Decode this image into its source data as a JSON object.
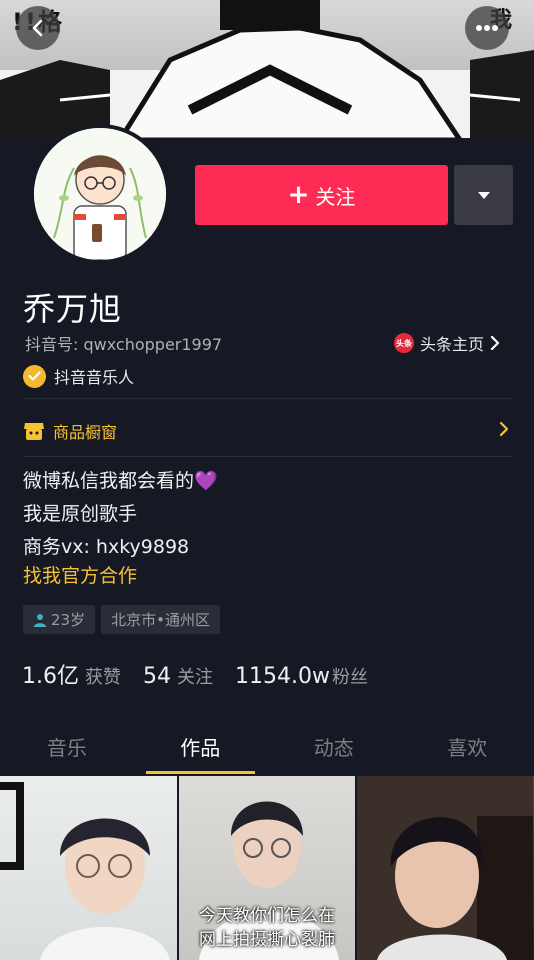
{
  "cover": {
    "text_left": "!!格",
    "text_right": "我"
  },
  "profile": {
    "name": "乔万旭",
    "douyin_id": "抖音号: qwxchopper1997",
    "toutiao_label": "头条主页",
    "toutiao_badge": "头条",
    "verified_label": "抖音音乐人",
    "follow_label": "关注",
    "follow_plus": "+",
    "shop_label": "商品橱窗",
    "bio": [
      "微博私信我都会看的💜",
      "我是原创歌手",
      "商务vx: hxky9898"
    ],
    "bio_link": "找我官方合作",
    "tags": {
      "age": "23岁",
      "location": "北京市•通州区"
    }
  },
  "stats": [
    {
      "num": "1.6亿",
      "label": "获赞"
    },
    {
      "num": "54",
      "label": "关注"
    },
    {
      "num": "1154.0w",
      "label": "粉丝"
    }
  ],
  "tabs": [
    "音乐",
    "作品",
    "动态",
    "喜欢"
  ],
  "active_tab": 1,
  "videos": [
    {
      "caption": ""
    },
    {
      "caption": "今天教你们怎么在\n网上拍摄撕心裂肺"
    },
    {
      "caption": ""
    }
  ],
  "colors": {
    "accent": "#fe2c55",
    "gold": "#f5c233",
    "bg": "#161823"
  }
}
